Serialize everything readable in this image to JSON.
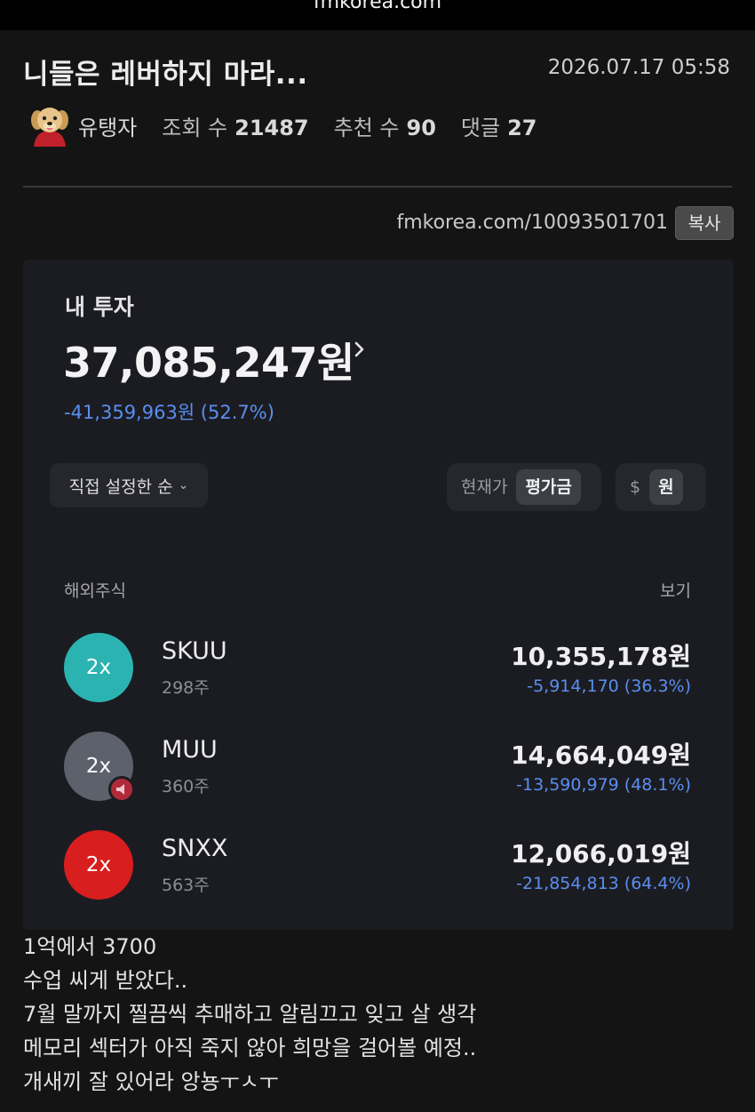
{
  "browser": {
    "url": "fmkorea.com"
  },
  "post": {
    "title": "니들은 레버하지 마라...",
    "datetime": "2026.07.17 05:58",
    "author": "유탱자",
    "views_label": "조회 수",
    "views": "21487",
    "recommend_label": "추천 수",
    "recommend": "90",
    "comments_label": "댓글",
    "comments": "27",
    "permalink": "fmkorea.com/10093501701",
    "copy_label": "복사",
    "body_lines": [
      "1억에서 3700",
      "수업 씨게 받았다..",
      "7월 말까지 찔끔씩 추매하고 알림끄고 잊고 살 생각",
      "메모리 섹터가 아직 죽지 않아 희망을 걸어볼 예정..",
      "개새끼 잘 있어라 앙뇽ㅜㅅㅜ"
    ]
  },
  "invest": {
    "label": "내 투자",
    "total": "37,085,247원",
    "total_change": "-41,359,963원 (52.7%)",
    "sort_label": "직접 설정한 순",
    "price_toggle": [
      "현재가",
      "평가금"
    ],
    "price_toggle_active": "평가금",
    "currency_toggle": [
      "$",
      "원"
    ],
    "currency_toggle_active": "원",
    "section_label": "해외주식",
    "view_label": "보기",
    "holdings": [
      {
        "badge": "2x",
        "ticker": "SKUU",
        "shares": "298주",
        "amount": "10,355,178원",
        "change": "-5,914,170 (36.3%)",
        "color": "#2bb3b1"
      },
      {
        "badge": "2x",
        "ticker": "MUU",
        "shares": "360주",
        "amount": "14,664,049원",
        "change": "-13,590,979 (48.1%)",
        "color": "#5d616b"
      },
      {
        "badge": "2x",
        "ticker": "SNXX",
        "shares": "563주",
        "amount": "12,066,019원",
        "change": "-21,854,813 (64.4%)",
        "color": "#d81e1e"
      }
    ]
  },
  "colors": {
    "loss": "#5a8ef0",
    "background": "#141414",
    "card": "#1b1c21"
  }
}
